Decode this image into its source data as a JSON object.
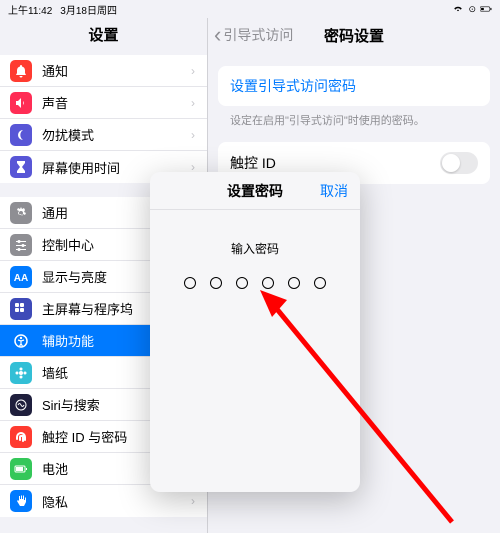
{
  "status": {
    "time": "上午11:42",
    "date": "3月18日周四"
  },
  "sidebar": {
    "title": "设置",
    "groups": [
      [
        {
          "label": "通知",
          "color": "#ff3b30",
          "icon": "bell"
        },
        {
          "label": "声音",
          "color": "#ff2d55",
          "icon": "sound"
        },
        {
          "label": "勿扰模式",
          "color": "#5856d6",
          "icon": "moon"
        },
        {
          "label": "屏幕使用时间",
          "color": "#5856d6",
          "icon": "hourglass"
        }
      ],
      [
        {
          "label": "通用",
          "color": "#8e8e93",
          "icon": "gear"
        },
        {
          "label": "控制中心",
          "color": "#8e8e93",
          "icon": "sliders"
        },
        {
          "label": "显示与亮度",
          "color": "#007aff",
          "icon": "aa"
        },
        {
          "label": "主屏幕与程序坞",
          "color": "#3e4ab8",
          "icon": "grid"
        },
        {
          "label": "辅助功能",
          "color": "#007aff",
          "icon": "access",
          "active": true
        },
        {
          "label": "墙纸",
          "color": "#33bfd6",
          "icon": "flower"
        },
        {
          "label": "Siri与搜索",
          "color": "#1f1f3d",
          "icon": "siri"
        },
        {
          "label": "触控 ID 与密码",
          "color": "#ff3b30",
          "icon": "finger"
        },
        {
          "label": "电池",
          "color": "#34c759",
          "icon": "battery"
        },
        {
          "label": "隐私",
          "color": "#007aff",
          "icon": "hand"
        }
      ]
    ]
  },
  "detail": {
    "back": "引导式访问",
    "title": "密码设置",
    "set_passcode": "设置引导式访问密码",
    "hint": "设定在启用\"引导式访问\"时使用的密码。",
    "touch_id": "触控 ID"
  },
  "modal": {
    "title": "设置密码",
    "cancel": "取消",
    "prompt": "输入密码",
    "digits": 6
  }
}
